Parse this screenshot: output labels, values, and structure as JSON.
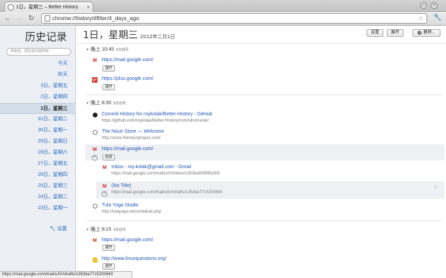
{
  "browser": {
    "tab_title": "1日，星期三 – Better History",
    "tab_close": "×",
    "url": "chrome://history/#filter/4_days_ago",
    "back": "←",
    "forward": "→",
    "reload": "↻",
    "star": "☆",
    "wrench": "🔧",
    "min": "–",
    "max": "+"
  },
  "sidebar": {
    "title": "历史记录",
    "search_placeholder": "搜索窗、网址或日期搜索",
    "items": [
      {
        "label": "今天"
      },
      {
        "label": "昨天"
      },
      {
        "label": "3日，星期五"
      },
      {
        "label": "2日，星期四"
      },
      {
        "label": "1日，星期三"
      },
      {
        "label": "31日，星期二"
      },
      {
        "label": "30日，星期一"
      },
      {
        "label": "29日，星期日"
      },
      {
        "label": "28日，星期六"
      },
      {
        "label": "27日，星期五"
      },
      {
        "label": "26日，星期四"
      },
      {
        "label": "25日，星期三"
      },
      {
        "label": "24日，星期二"
      },
      {
        "label": "23日，星期一"
      }
    ],
    "settings_label": "设置",
    "settings_icon": "🔧"
  },
  "header": {
    "title": "1日，星期三",
    "subtitle": "2012年二月1日",
    "buttons": {
      "edit": "设置",
      "expand": "展开",
      "delete": "删除..."
    }
  },
  "groups": [
    {
      "time": "晚上 10:45",
      "count": "5次访问",
      "entries": [
        {
          "icon": "gmail",
          "title": "https://mail.google.com/",
          "button": "展开"
        },
        {
          "icon": "gplus",
          "title": "https://plus.google.com/",
          "button": "展开"
        }
      ]
    },
    {
      "time": "晚上 8:30",
      "count": "5次访问",
      "entries": [
        {
          "icon": "github",
          "title": "Commit History for roykolak/Better-History - GitHub",
          "url": "https://github.com/roykolak/Better-History/commits/master"
        },
        {
          "icon": "globe",
          "title": "The Noun Store — Welcome",
          "url": "http://store.thenounproject.com/"
        },
        {
          "icon": "gmail",
          "title": "https://mail.google.com/",
          "button": "收拢"
        },
        {
          "icon": "gmail",
          "title": "Inbox - roy.kolak@gmail.com - Gmail",
          "url": "https://mail.google.com/mail/u/0/#inbox/1353baf09895c63f"
        },
        {
          "icon": "gmail",
          "title": "(No Title)",
          "url": "https://mail.google.com/mail/u/0/#drafts/1353be77c5200660"
        },
        {
          "icon": "globe",
          "title": "Tula Yoga Studio",
          "url": "http://tulayoga.net/schedule.php"
        }
      ]
    },
    {
      "time": "晚上 8:15",
      "count": "4次访问",
      "entries": [
        {
          "icon": "gmail",
          "title": "https://mail.google.com/",
          "button": "展开"
        },
        {
          "icon": "linuxquestions",
          "title": "http://www.linuxquestions.org/",
          "button": "展开"
        }
      ]
    }
  ],
  "status_bar": "https://mail.google.com/mail/u/0/#drafts/1353be77c5200660"
}
